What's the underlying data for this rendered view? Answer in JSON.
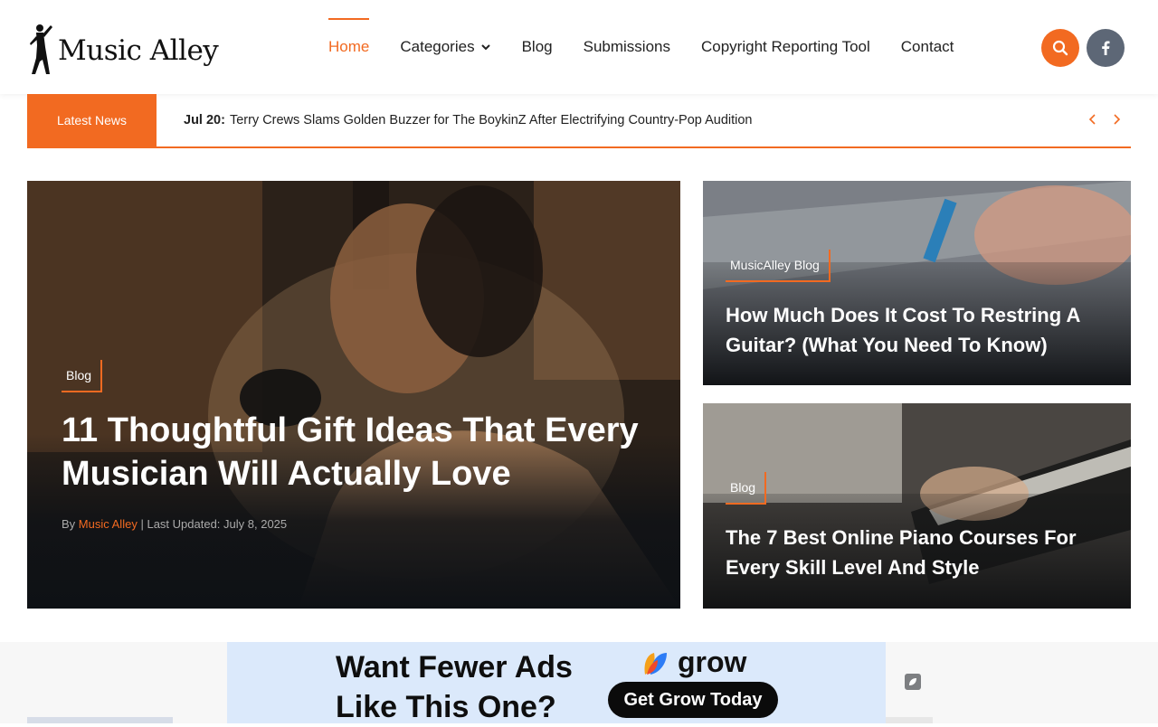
{
  "logo": {
    "text": "Music Alley"
  },
  "nav": {
    "items": [
      {
        "label": "Home",
        "active": true
      },
      {
        "label": "Categories",
        "has_dropdown": true
      },
      {
        "label": "Blog"
      },
      {
        "label": "Submissions"
      },
      {
        "label": "Copyright Reporting Tool"
      },
      {
        "label": "Contact"
      }
    ]
  },
  "header_icons": {
    "search": "search-icon",
    "social": "facebook-icon"
  },
  "ticker": {
    "label": "Latest News",
    "date": "Jul 20:",
    "headline": "Terry Crews Slams Golden Buzzer for The BoykinZ After Electrifying Country-Pop Audition"
  },
  "featured": {
    "main": {
      "category": "Blog",
      "title": "11 Thoughtful Gift Ideas That Every Musician Will Actually Love",
      "by": "By",
      "author": "Music Alley",
      "separator": "|",
      "updated": "Last Updated: July 8, 2025"
    },
    "side": [
      {
        "category": "MusicAlley Blog",
        "title": "How Much Does It Cost To Restring A Guitar? (What You Need To Know)"
      },
      {
        "category": "Blog",
        "title": "The 7 Best Online Piano Courses For Every Skill Level And Style"
      }
    ]
  },
  "ad": {
    "headline_line1": "Want Fewer Ads",
    "headline_line2": "Like This One?",
    "brand": "grow",
    "cta": "Get Grow Today"
  },
  "colors": {
    "accent": "#f26a21",
    "social_bg": "#5d6776",
    "ad_bg": "#dbe9fb"
  }
}
